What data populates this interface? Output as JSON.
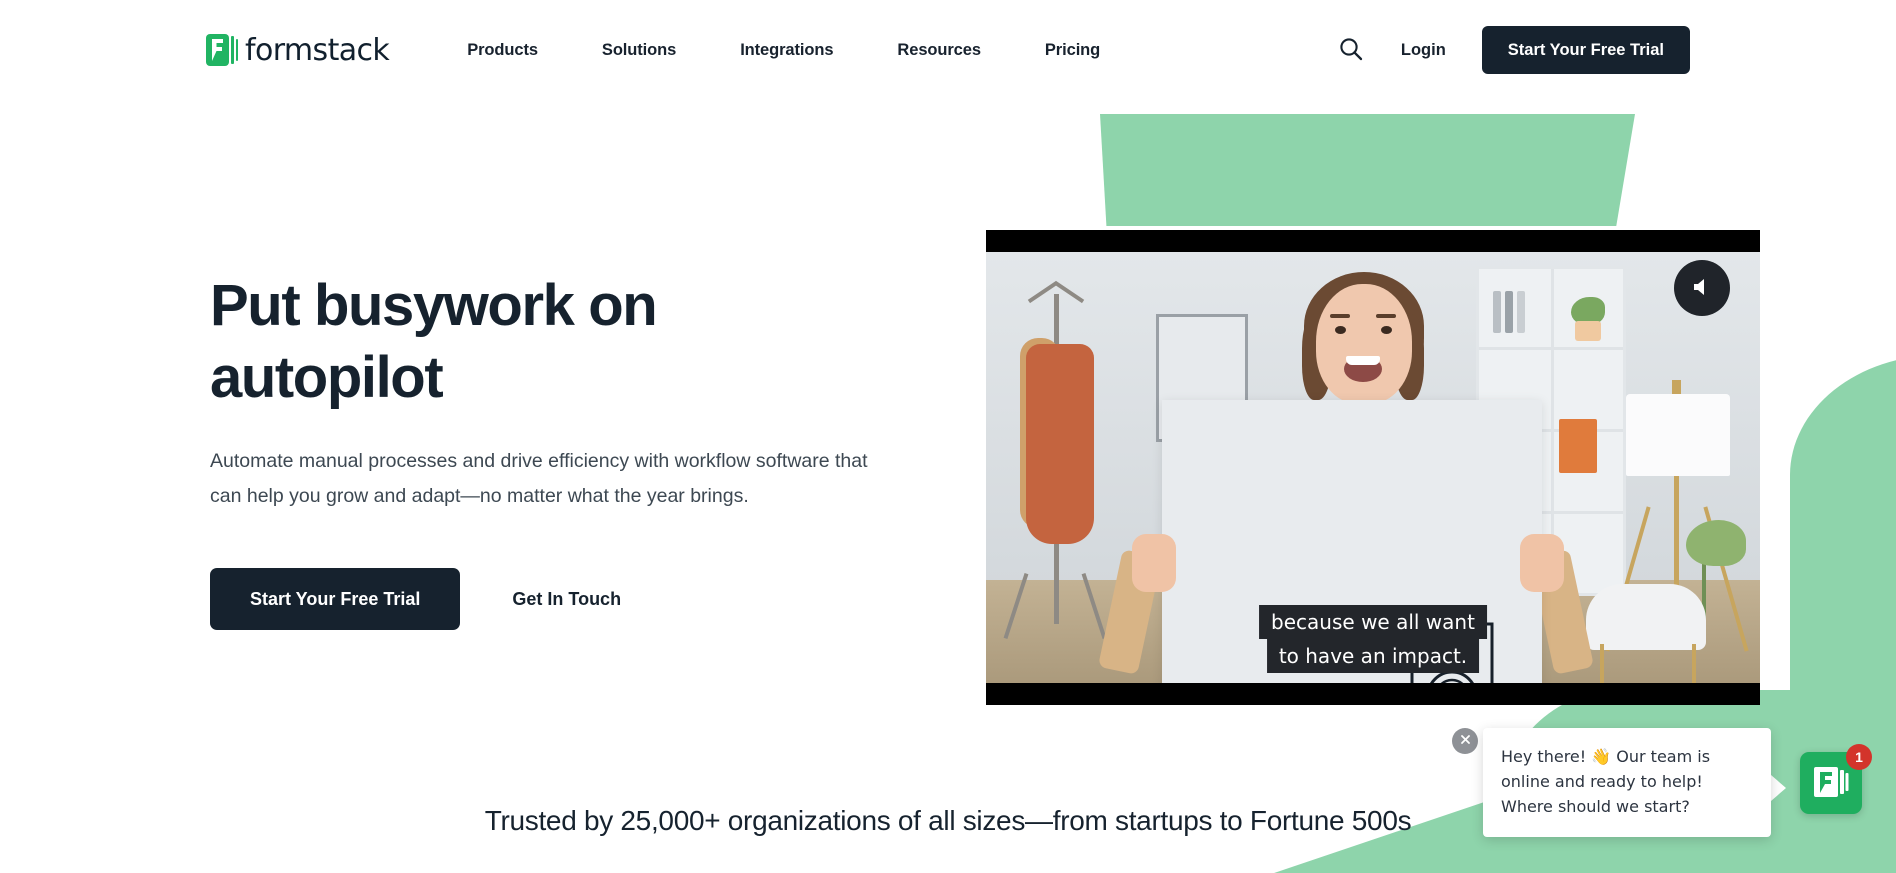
{
  "brand": {
    "name": "formstack",
    "logo_icon": "formstack-logo-icon",
    "green": "#21b463",
    "dark": "#16222e",
    "mint": "#8ed4ab",
    "badge_red": "#d3342b"
  },
  "header": {
    "nav_items": [
      {
        "label": "Products"
      },
      {
        "label": "Solutions"
      },
      {
        "label": "Integrations"
      },
      {
        "label": "Resources"
      },
      {
        "label": "Pricing"
      }
    ],
    "search_icon": "search-icon",
    "login_label": "Login",
    "cta_label": "Start Your Free Trial"
  },
  "hero": {
    "title": "Put busywork on autopilot",
    "subtitle": "Automate manual processes and drive efficiency with workflow software that can help you grow and adapt—no matter what the year brings.",
    "primary_cta": "Start Your Free Trial",
    "secondary_cta": "Get In Touch"
  },
  "video": {
    "mute_icon": "speaker-mute-icon",
    "caption_line_1": "because we all want",
    "caption_line_2": "to have an impact.",
    "board_icon": "award-ribbon-icon"
  },
  "trust": {
    "text": "Trusted by 25,000+ organizations of all sizes—from startups to Fortune 500s"
  },
  "chat": {
    "close_icon": "close-icon",
    "message": "Hey there! 👋 Our team is online and ready to help! Where should we start?",
    "launcher_icon": "formstack-chat-icon",
    "unread_count": "1"
  }
}
